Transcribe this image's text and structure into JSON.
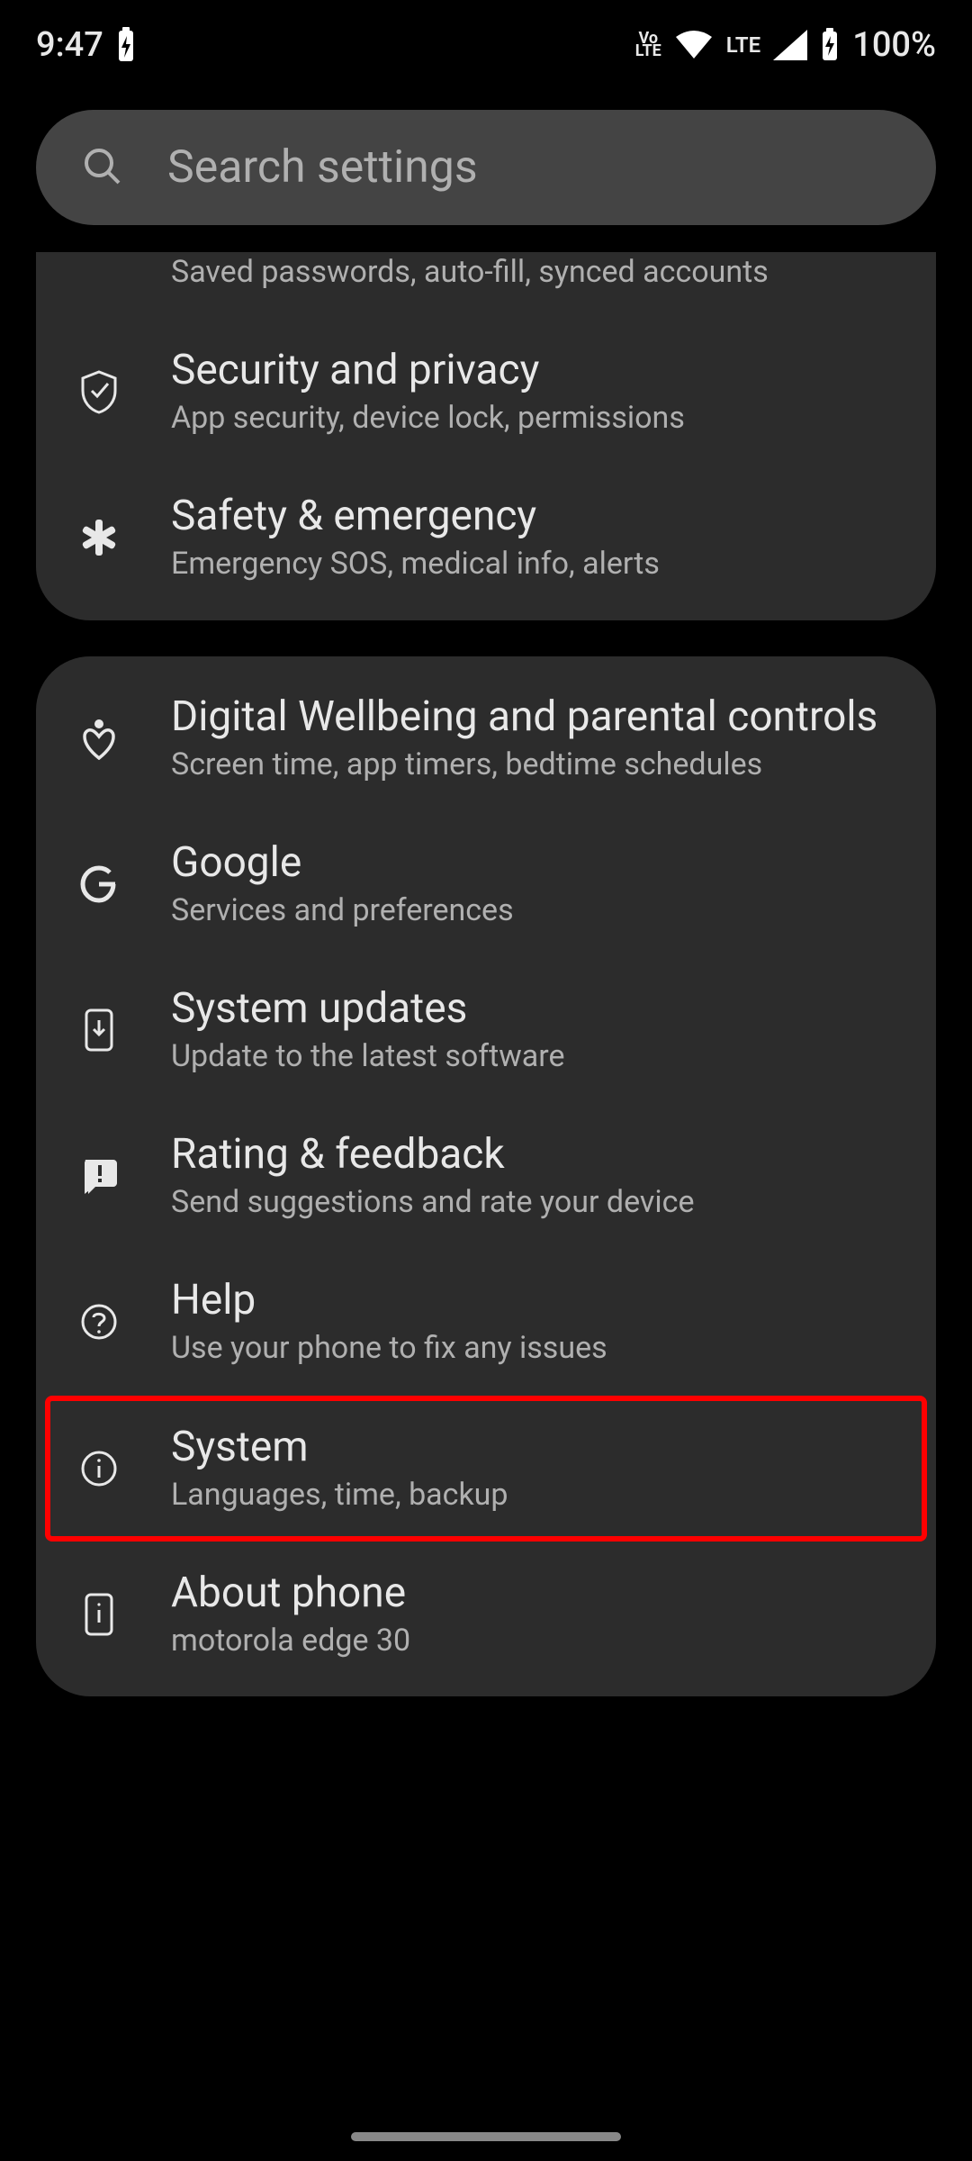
{
  "statusbar": {
    "time": "9:47",
    "volte": "Vo",
    "volte2": "LTE",
    "netlabel": "LTE",
    "battery": "100%"
  },
  "search": {
    "placeholder": "Search settings"
  },
  "groups": [
    {
      "partialTop": true,
      "items": [
        {
          "icon": "",
          "title": "",
          "subtitle": "Saved passwords, auto-fill, synced accounts",
          "partial": true
        },
        {
          "icon": "shield-check",
          "title": "Security and privacy",
          "subtitle": "App security, device lock, permissions"
        },
        {
          "icon": "asterisk",
          "title": "Safety & emergency",
          "subtitle": "Emergency SOS, medical info, alerts"
        }
      ]
    },
    {
      "items": [
        {
          "icon": "wellbeing",
          "title": "Digital Wellbeing and parental controls",
          "subtitle": "Screen time, app timers, bedtime schedules"
        },
        {
          "icon": "google",
          "title": "Google",
          "subtitle": "Services and preferences"
        },
        {
          "icon": "phone-download",
          "title": "System updates",
          "subtitle": "Update to the latest software"
        },
        {
          "icon": "feedback",
          "title": "Rating & feedback",
          "subtitle": "Send suggestions and rate your device"
        },
        {
          "icon": "help",
          "title": "Help",
          "subtitle": "Use your phone to fix any issues"
        },
        {
          "icon": "info",
          "title": "System",
          "subtitle": "Languages, time, backup",
          "highlight": true
        },
        {
          "icon": "phone-info",
          "title": "About phone",
          "subtitle": "motorola edge 30"
        }
      ]
    }
  ]
}
